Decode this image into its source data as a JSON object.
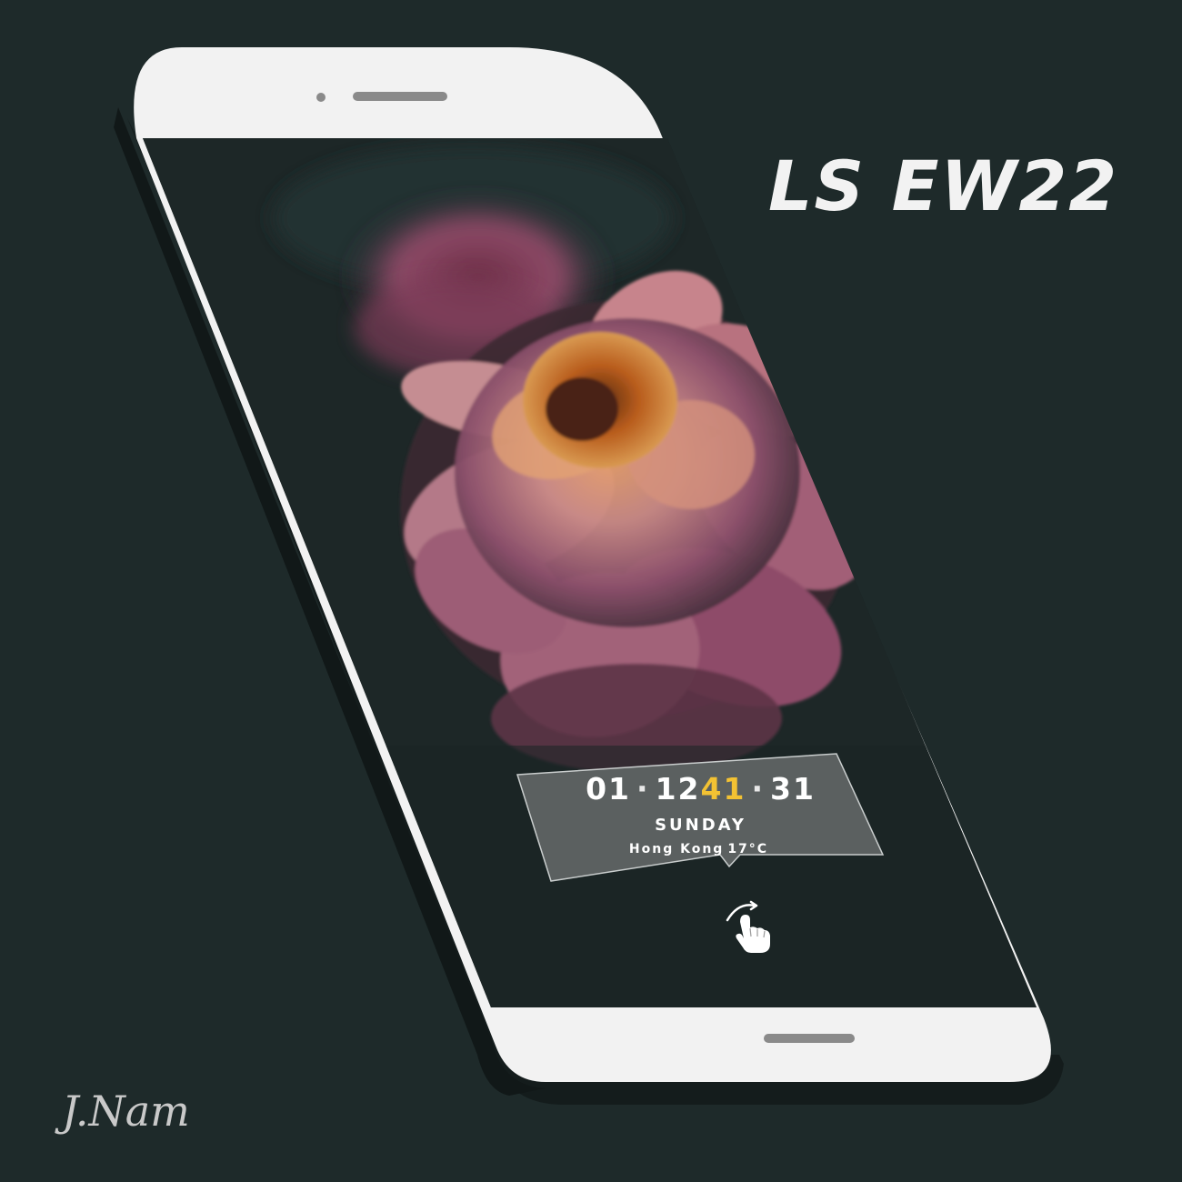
{
  "headline": "LS EW22",
  "signature": "J.Nam",
  "widget": {
    "hour": "01",
    "minute_prefix": "12",
    "minute_highlight": "41",
    "seconds": "31",
    "separator": "·",
    "day": "SUNDAY",
    "city": "Hong Kong",
    "temperature": "17°C"
  },
  "icons": {
    "gesture": "swipe-hand-icon",
    "earpiece": "earpiece-speaker-icon",
    "camera": "front-camera-icon",
    "home": "home-bar-icon"
  },
  "colors": {
    "background": "#1e2a2a",
    "phone_body": "#f2f2f2",
    "screen": "#1c2626",
    "accent": "#f3c233"
  }
}
